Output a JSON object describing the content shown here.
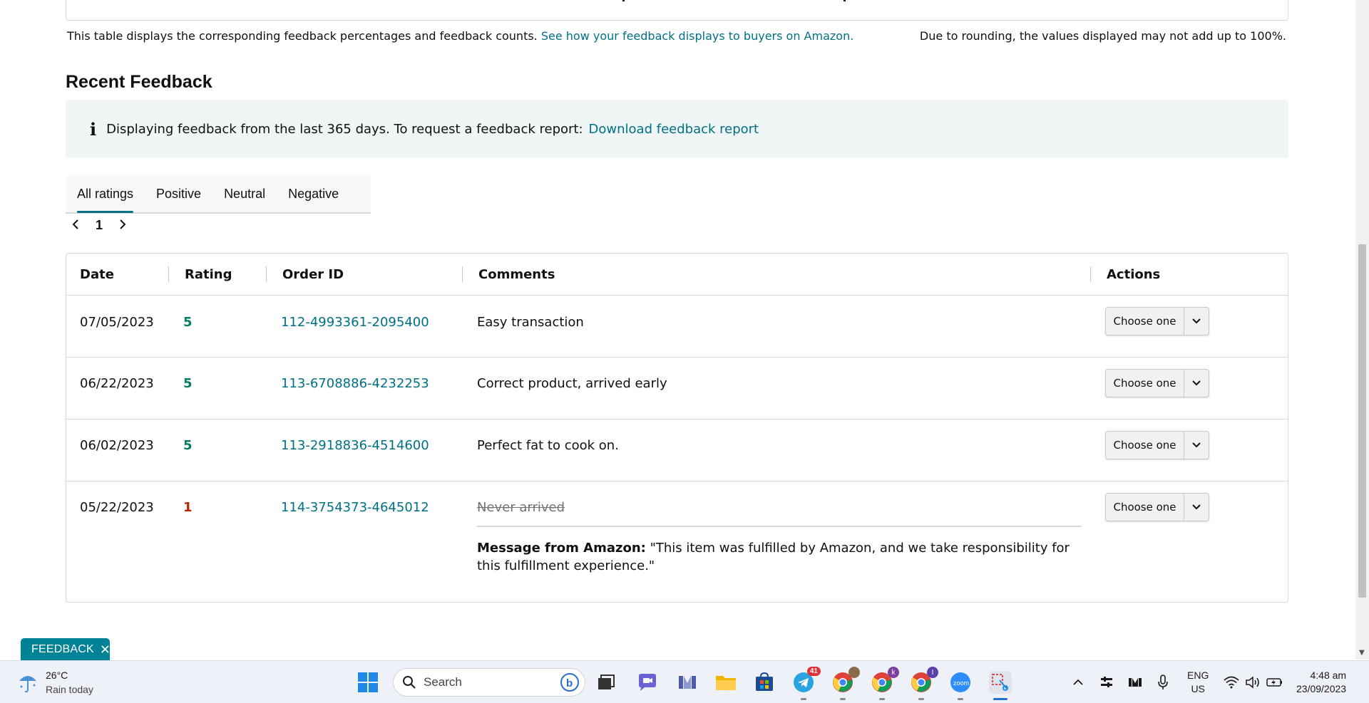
{
  "summary": {
    "note_text": "This table displays the corresponding feedback percentages and feedback counts.",
    "note_link": "See how your feedback displays to buyers on Amazon.",
    "rounding_note": "Due to rounding, the values displayed may not add up to 100%."
  },
  "recent": {
    "title": "Recent Feedback",
    "info_icon": "i",
    "info_text": "Displaying feedback from the last 365 days. To request a feedback report:",
    "info_link": "Download feedback report"
  },
  "tabs": [
    {
      "label": "All ratings",
      "active": true
    },
    {
      "label": "Positive",
      "active": false
    },
    {
      "label": "Neutral",
      "active": false
    },
    {
      "label": "Negative",
      "active": false
    }
  ],
  "pager": {
    "current_page": "1"
  },
  "table": {
    "headers": {
      "date": "Date",
      "rating": "Rating",
      "order_id": "Order ID",
      "comments": "Comments",
      "actions": "Actions"
    },
    "rows": [
      {
        "date": "07/05/2023",
        "rating": "5",
        "order_id": "112-4993361-2095400",
        "comment": "Easy transaction",
        "action": "Choose one"
      },
      {
        "date": "06/22/2023",
        "rating": "5",
        "order_id": "113-6708886-4232253",
        "comment": "Correct product, arrived early",
        "action": "Choose one"
      },
      {
        "date": "06/02/2023",
        "rating": "5",
        "order_id": "113-2918836-4514600",
        "comment": "Perfect fat to cook on.",
        "action": "Choose one"
      },
      {
        "date": "05/22/2023",
        "rating": "1",
        "order_id": "114-3754373-4645012",
        "comment": "Never arrived",
        "action": "Choose one",
        "amazon_label": "Message from Amazon:",
        "amazon_message": "\"This item was fulfilled by Amazon, and we take responsibility for this fulfillment experience.\""
      }
    ]
  },
  "feedback_widget": {
    "label": "FEEDBACK",
    "close": "✕"
  },
  "taskbar": {
    "weather_temp": "26°C",
    "weather_desc": "Rain today",
    "search_placeholder": "Search",
    "telegram_badge": "41",
    "chrome_profile_1": "k",
    "chrome_profile_2": "I",
    "zoom_label": "zoom",
    "lang_1": "ENG",
    "lang_2": "US",
    "time": "4:48 am",
    "date": "23/09/2023"
  },
  "colors": {
    "link": "#007185",
    "positive": "#067d62",
    "negative": "#b12704",
    "accent": "#008296"
  }
}
